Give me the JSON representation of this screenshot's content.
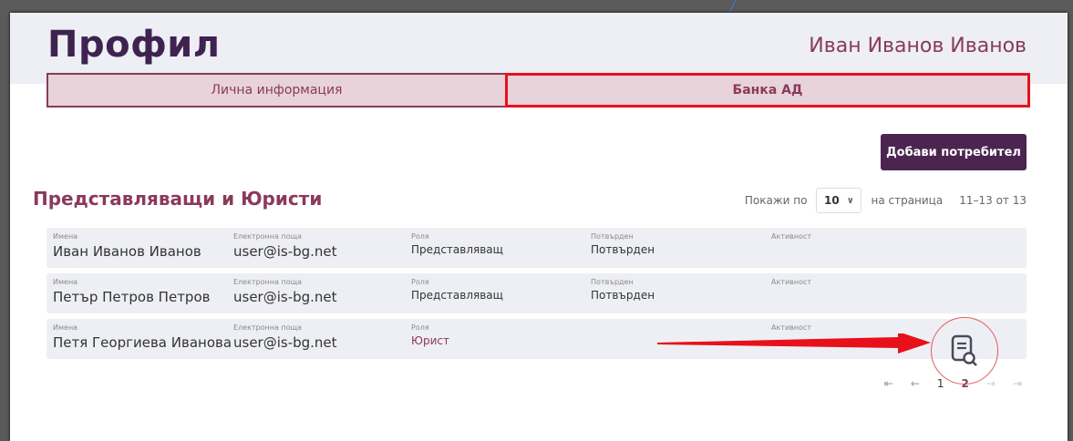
{
  "header": {
    "title": "Профил",
    "user_name": "Иван Иванов Иванов"
  },
  "tabs": [
    {
      "label": "Лична информация",
      "active": false
    },
    {
      "label": "Банка АД",
      "active": true
    }
  ],
  "actions": {
    "add_user": "Добави потребител"
  },
  "section": {
    "title": "Представляващи и Юристи"
  },
  "pagination": {
    "show_prefix": "Покажи по",
    "page_size": "10",
    "per_page_suffix": "на страница",
    "range": "11–13 от 13",
    "pages": [
      "1",
      "2"
    ],
    "current_page": "2"
  },
  "columns": {
    "name": "Имена",
    "email": "Електронна поща",
    "role": "Роля",
    "confirmed": "Потвърден",
    "activity": "Активност"
  },
  "rows": [
    {
      "name": "Иван Иванов Иванов",
      "email": "user@is-bg.net",
      "role": "Представляващ",
      "confirmed": "Потвърден"
    },
    {
      "name": "Петър Петров Петров",
      "email": "user@is-bg.net",
      "role": "Представляващ",
      "confirmed": "Потвърден"
    },
    {
      "name": "Петя Георгиева Иванова",
      "email": "user@is-bg.net",
      "role": "Юрист",
      "confirmed": ""
    }
  ],
  "colors": {
    "brand_dark": "#4b2550",
    "accent": "#8a3a5a",
    "highlight": "#e8101a"
  }
}
